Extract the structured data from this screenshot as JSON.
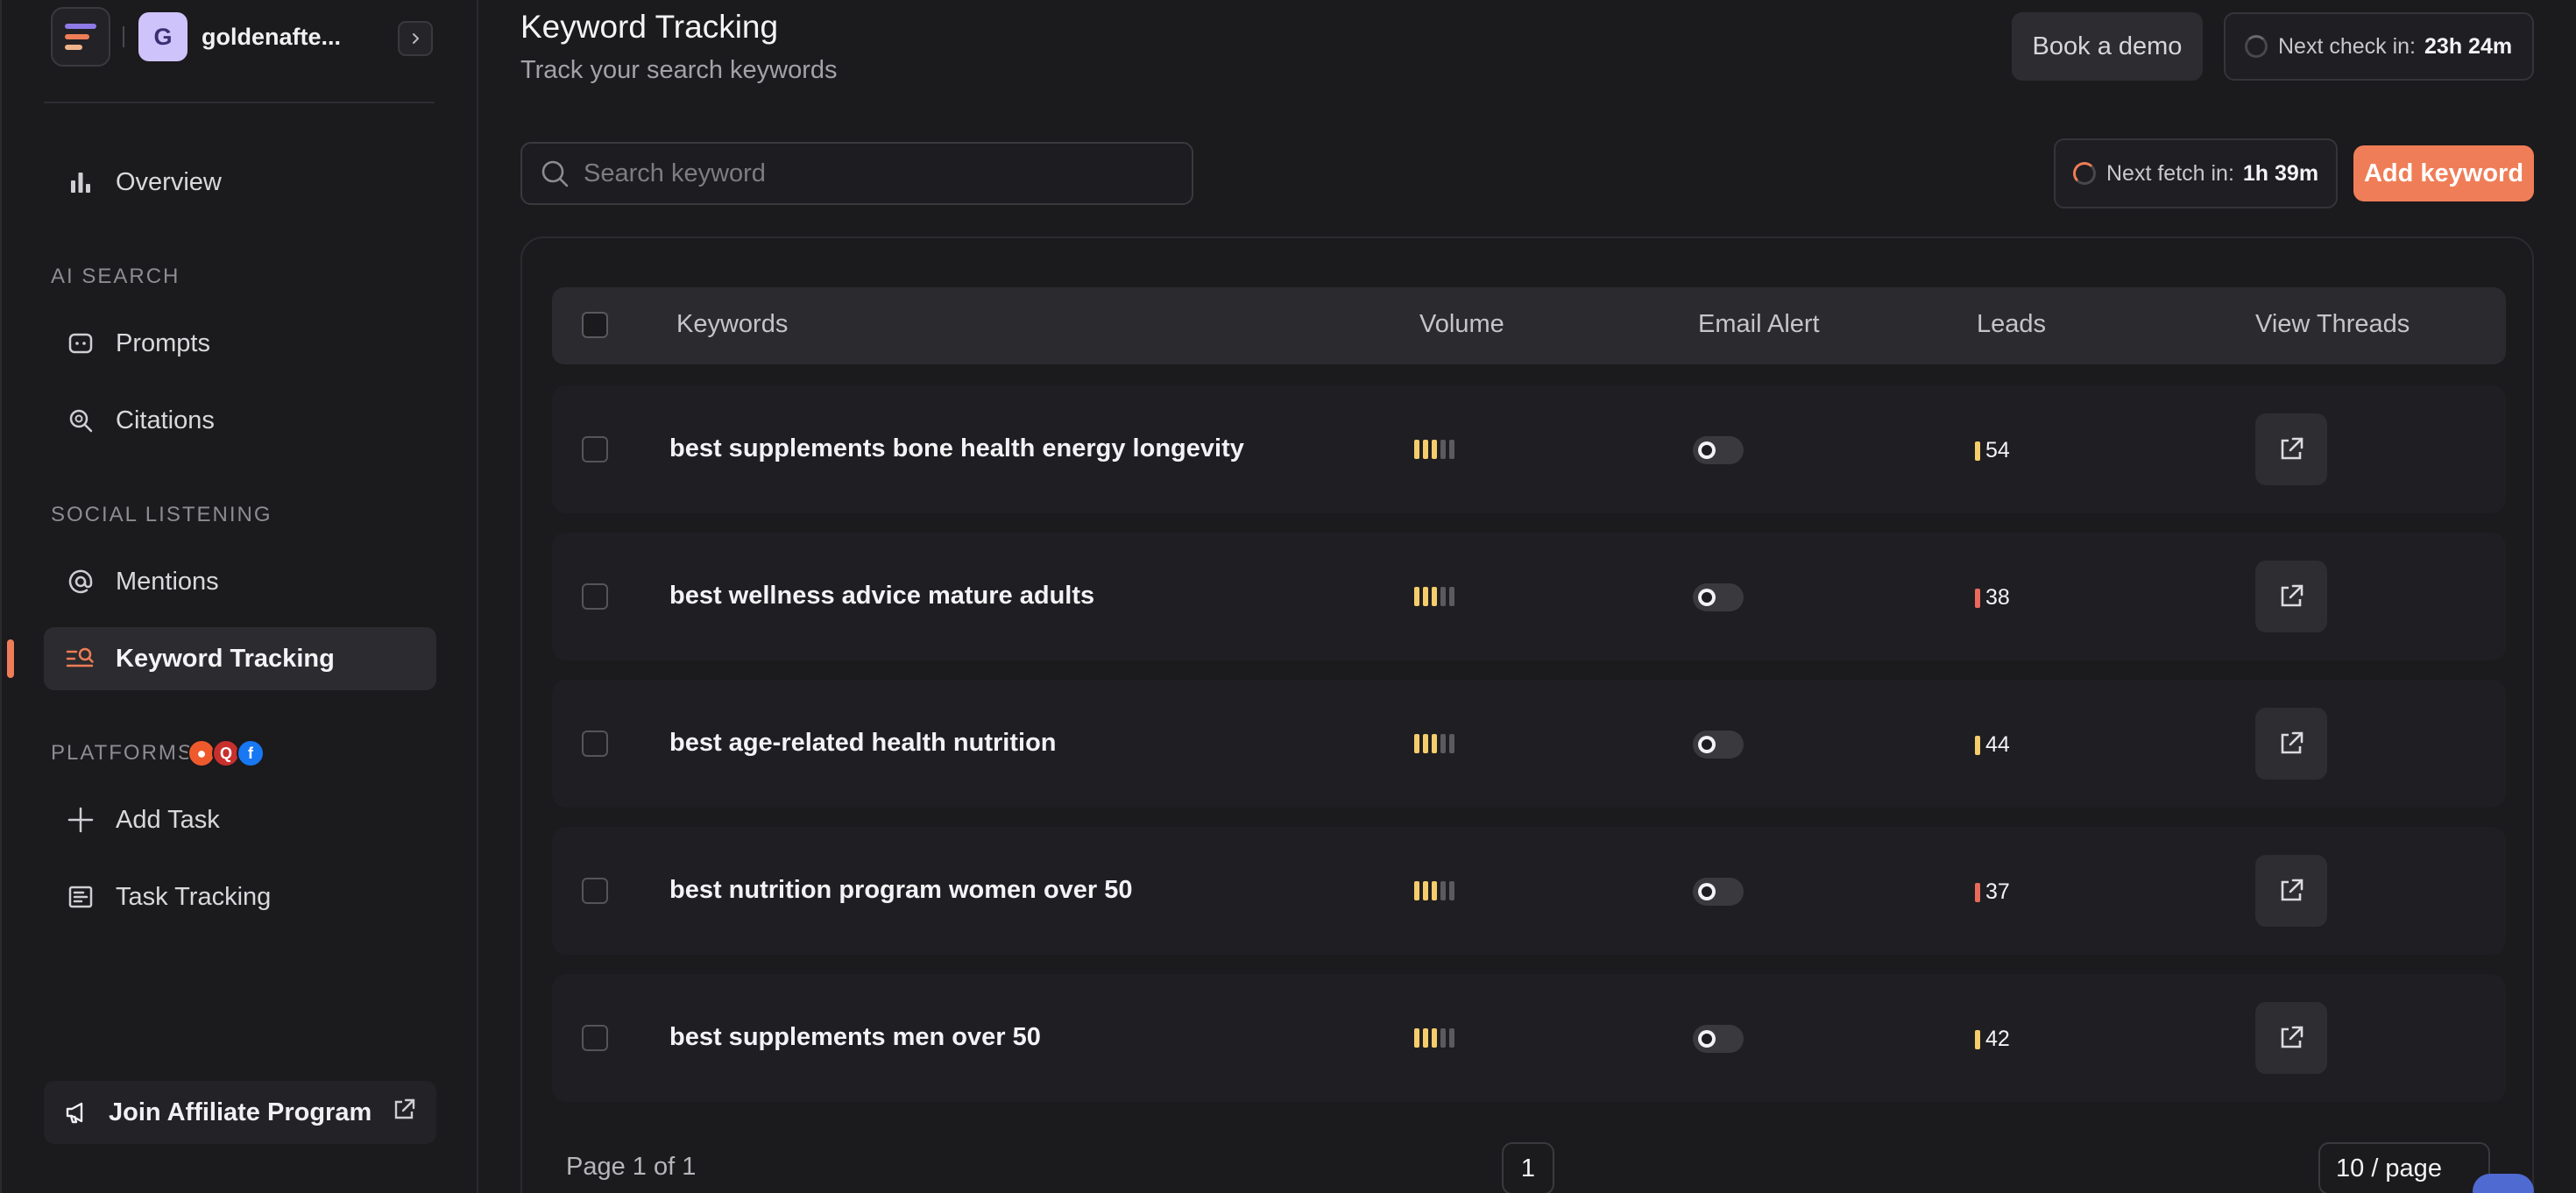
{
  "workspace": {
    "initial": "G",
    "name": "goldenafte..."
  },
  "nav": {
    "overview": "Overview",
    "ai_search_label": "AI SEARCH",
    "prompts": "Prompts",
    "citations": "Citations",
    "social_listening_label": "SOCIAL LISTENING",
    "mentions": "Mentions",
    "keyword_tracking": "Keyword Tracking",
    "platforms_label": "PLATFORMS",
    "add_task": "Add Task",
    "task_tracking": "Task Tracking",
    "affiliate": "Join Affiliate Program"
  },
  "header": {
    "title": "Keyword Tracking",
    "subtitle": "Track your search keywords",
    "book_demo": "Book a demo",
    "next_check_label": "Next check in:",
    "next_check_value": "23h 24m"
  },
  "toolbar": {
    "search_placeholder": "Search keyword",
    "next_fetch_label": "Next fetch in:",
    "next_fetch_value": "1h 39m",
    "add_keyword": "Add keyword"
  },
  "table": {
    "columns": [
      "Keywords",
      "Volume",
      "Email Alert",
      "Leads",
      "View Threads"
    ],
    "rows": [
      {
        "keyword": "best supplements bone health energy longevity",
        "volume_level": 3,
        "email_alert": false,
        "leads": "54",
        "leads_color": "#f5cd6b"
      },
      {
        "keyword": "best wellness advice mature adults",
        "volume_level": 3,
        "email_alert": false,
        "leads": "38",
        "leads_color": "#e9695a"
      },
      {
        "keyword": "best age-related health nutrition",
        "volume_level": 3,
        "email_alert": false,
        "leads": "44",
        "leads_color": "#f5cd6b"
      },
      {
        "keyword": "best nutrition program women over 50",
        "volume_level": 3,
        "email_alert": false,
        "leads": "37",
        "leads_color": "#e9695a"
      },
      {
        "keyword": "best supplements men over 50",
        "volume_level": 3,
        "email_alert": false,
        "leads": "42",
        "leads_color": "#f5cd6b"
      }
    ]
  },
  "pagination": {
    "summary": "Page 1 of 1",
    "current": "1",
    "page_size": "10 / page"
  },
  "colors": {
    "accent": "#ef7d57",
    "volume_on": "#f5cd6b",
    "volume_off": "#5b5a60"
  },
  "icons": {
    "platforms": [
      "reddit-icon",
      "quora-icon",
      "facebook-icon"
    ]
  }
}
